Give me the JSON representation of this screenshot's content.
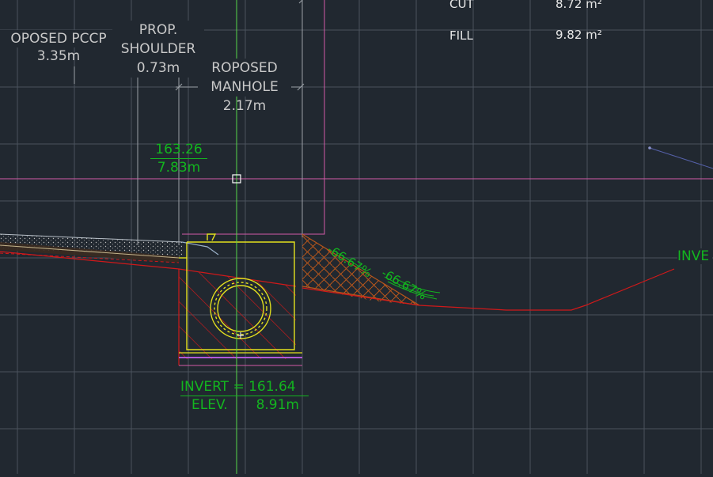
{
  "labels": {
    "pccp_title": "OPOSED PCCP",
    "pccp_width": "3.35m",
    "shoulder_title_1": "PROP.",
    "shoulder_title_2": "SHOULDER",
    "shoulder_width": "0.73m",
    "manhole_title_1": "ROPOSED",
    "manhole_title_2": "MANHOLE",
    "manhole_width": "2.17m",
    "station_elev": "163.26",
    "station_offset": "7.83m",
    "invert_text": "INVERT = 161.64",
    "elev_text": "ELEV.",
    "elev_value": "8.91m",
    "slope_label_1": "-66.67%",
    "slope_label_2": "-66.67%",
    "right_invert": "INVE"
  },
  "areas": {
    "cut_label": "CUT",
    "cut_value": "8.72 m²",
    "fill_label": "FILL",
    "fill_value": "9.82 m²"
  },
  "colors": {
    "background": "#212830",
    "grid": "#4a525d",
    "text_white": "#e8e8e8",
    "text_gray": "#c9c9c9",
    "text_green": "#13b51f",
    "cut_red": "#d0191a",
    "fill_brown": "#b8561b",
    "manhole_yellow": "#e3e01e",
    "design_pink": "#d25aa8",
    "centerline_green": "#58d84a"
  }
}
